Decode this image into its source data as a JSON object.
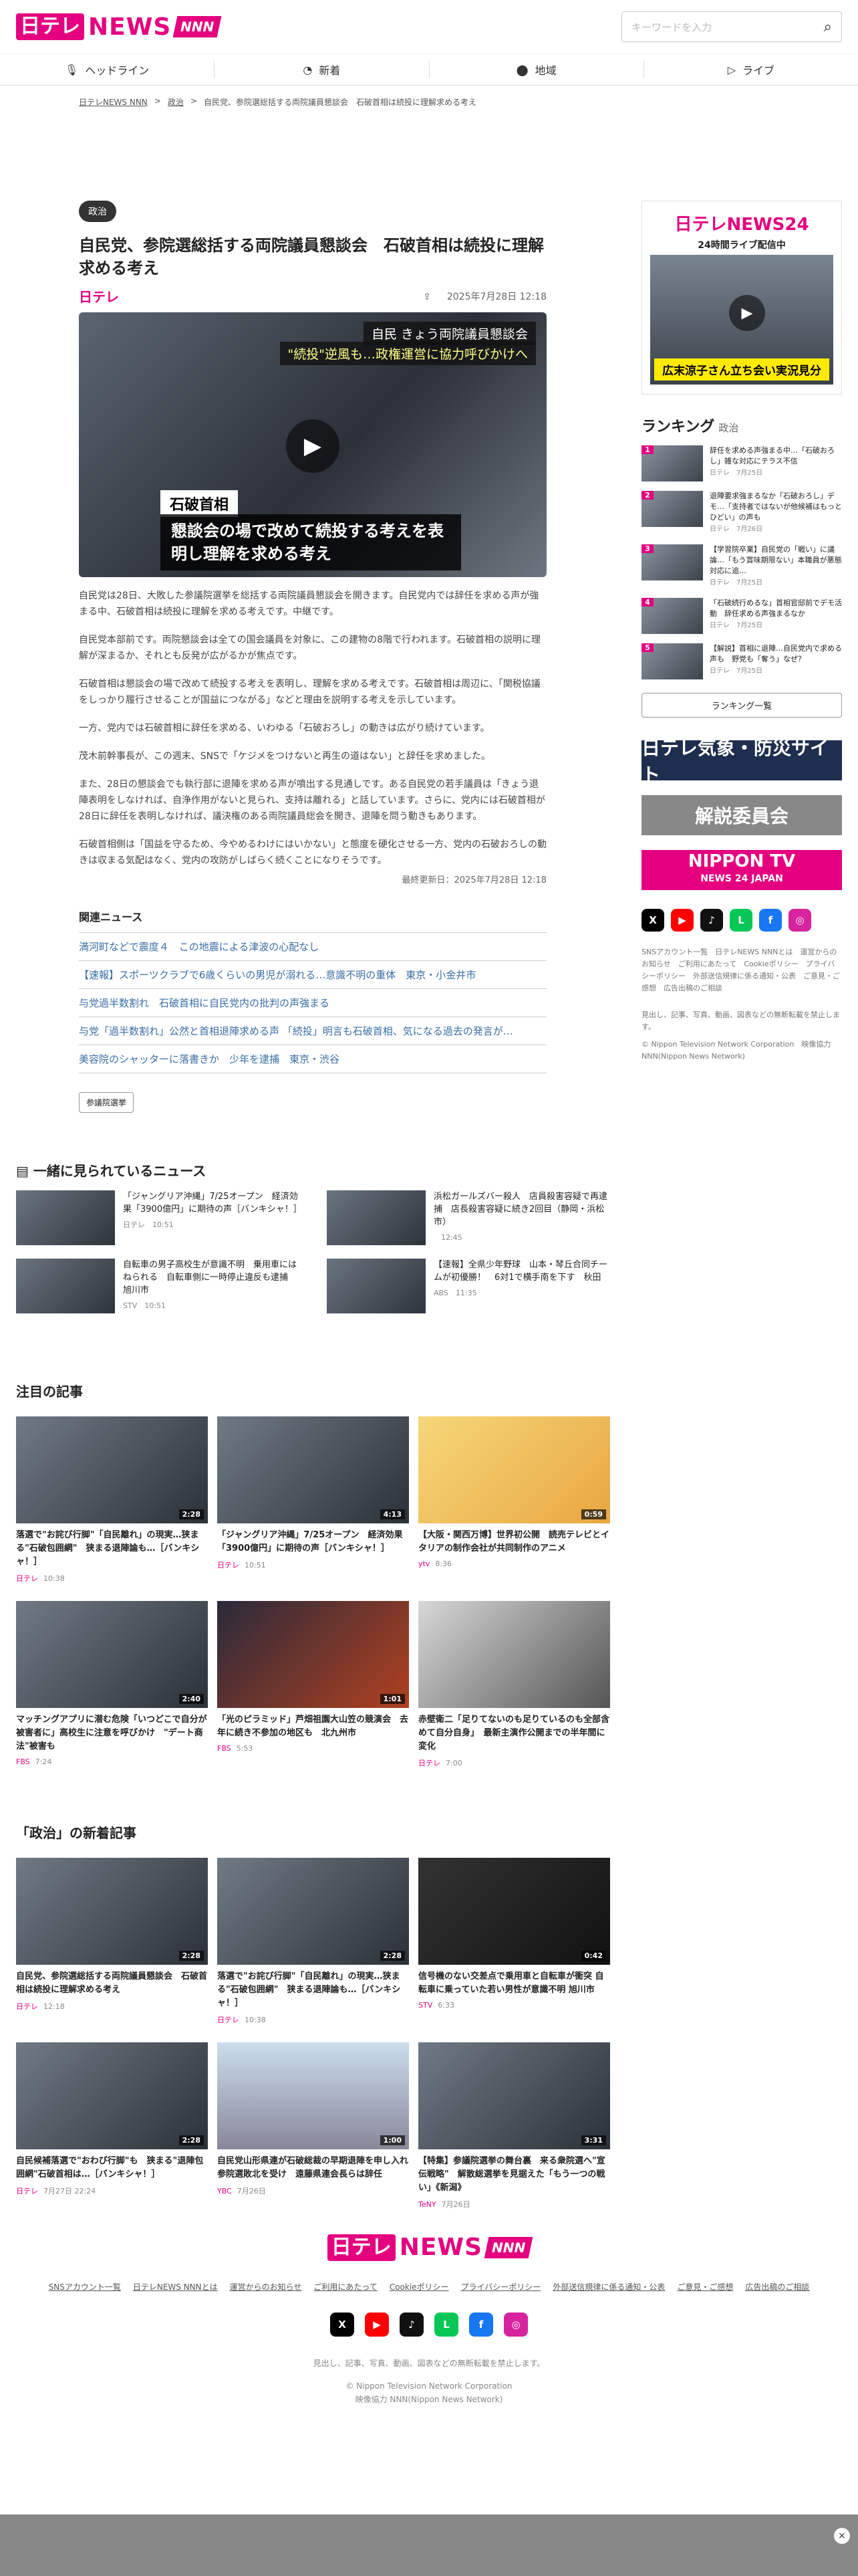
{
  "header": {
    "logo_ntv": "日テレ",
    "logo_news": "NEWS",
    "logo_nnn": "NNN",
    "search_placeholder": "キーワードを入力",
    "search_icon": "search-icon"
  },
  "nav": [
    {
      "label": "ヘッドライン",
      "icon": "mic-icon"
    },
    {
      "label": "新着",
      "icon": "new-icon"
    },
    {
      "label": "地域",
      "icon": "map-pin-icon"
    },
    {
      "label": "ライブ",
      "icon": "play-icon"
    }
  ],
  "breadcrumb": [
    "日テレNEWS NNN",
    "政治",
    "自民党、参院選総括する両院議員懇談会　石破首相は続投に理解求める考え"
  ],
  "article": {
    "category": "政治",
    "title": "自民党、参院選総括する両院議員懇談会　石破首相は続投に理解求める考え",
    "source": "日テレ",
    "date": "2025年7月28日 12:18",
    "hero_caption1": "自民 きょう両院議員懇談会",
    "hero_caption2": "\"続投\"逆風も…政権運営に協力呼びかけへ",
    "hero_name": "石破首相",
    "hero_sub": "懇談会の場で改めて続投する考えを表明し理解を求める考え",
    "paragraphs": [
      "自民党は28日、大敗した参議院選挙を総括する両院議員懇談会を開きます。自民党内では辞任を求める声が強まる中、石破首相は続投に理解を求める考えです。中継です。",
      "自民党本部前です。両院懇談会は全ての国会議員を対象に、この建物の8階で行われます。石破首相の説明に理解が深まるか、それとも反発が広がるかが焦点です。",
      "石破首相は懇談会の場で改めて続投する考えを表明し、理解を求める考えです。石破首相は周辺に、「関税協議をしっかり履行させることが国益につながる」などと理由を説明する考えを示しています。",
      "一方、党内では石破首相に辞任を求める、いわゆる「石破おろし」の動きは広がり続けています。",
      "茂木前幹事長が、この週末、SNSで「ケジメをつけないと再生の道はない」と辞任を求めました。",
      "また、28日の懇談会でも執行部に退陣を求める声が噴出する見通しです。ある自民党の若手議員は「きょう退陣表明をしなければ、自浄作用がないと見られ、支持は離れる」と話しています。さらに、党内には石破首相が28日に辞任を表明しなければ、議決権のある両院議員総会を開き、退陣を問う動きもあります。",
      "石破首相側は「国益を守るため、今やめるわけにはいかない」と態度を硬化させる一方、党内の石破おろしの動きは収まる気配はなく、党内の攻防がしばらく続くことになりそうです。"
    ],
    "updated": "最終更新日：2025年7月28日 12:18"
  },
  "related": {
    "heading": "関連ニュース",
    "items": [
      "満河町などで震度４　この地震による津波の心配なし",
      "【速報】スポーツクラブで6歳くらいの男児が溺れる…意識不明の重体　東京・小金井市",
      "与党過半数割れ　石破首相に自民党内の批判の声強まる",
      "与党「過半数割れ」公然と首相退陣求める声 「続投」明言も石破首相、気になる過去の発言が…",
      "美容院のシャッターに落書きか　少年を逮捕　東京・渋谷"
    ],
    "keyword": "参議院選挙"
  },
  "sidebar": {
    "live_title": "日テレNEWS24",
    "live_sub": "24時間ライブ配信中",
    "live_ticker": "広末涼子さん立ち会い実況見分",
    "ranking_heading": "ランキング",
    "ranking_category": "政治",
    "ranking": [
      {
        "rank": "1",
        "title": "辞任を求める声強まる中…「石破おろし」雑な対応にテラス不信",
        "src": "日テレ",
        "date": "7月25日"
      },
      {
        "rank": "2",
        "title": "退陣要求強まるなか「石破おろし」デモ…「支持者ではないが他候補はもっとひどい」の声も",
        "src": "日テレ",
        "date": "7月26日"
      },
      {
        "rank": "3",
        "title": "【学習院卒業】自民党の「戦い」に議論…「もう賞味期限ない」本職員が悪態対応に追…",
        "src": "日テレ",
        "date": "7月25日"
      },
      {
        "rank": "4",
        "title": "「石破続行めるな」首相官邸前でデモ活動　辞任求める声強まるなか",
        "src": "日テレ",
        "date": "7月25日"
      },
      {
        "rank": "5",
        "title": "【解説】首相に退陣…自民党内で求める声も　野党も「奪う」なぜ？",
        "src": "日テレ",
        "date": "7月25日"
      }
    ],
    "ranking_more": "ランキング一覧",
    "banner1": "日テレ気象・防災サイト",
    "banner2": "解説委員会",
    "banner3_line1": "NIPPON TV",
    "banner3_line2": "NEWS 24 JAPAN",
    "social": [
      "X",
      "▶",
      "♪",
      "L",
      "f",
      "◎"
    ],
    "links": "SNSアカウント一覧　日テレNEWS NNNとは　運営からのお知らせ　ご利用にあたって　Cookieポリシー　プライバシーポリシー　外部送信規律に係る通知・公表　ご意見・ご感想　広告出稿のご相談",
    "note": "見出し、記事、写真、動画、図表などの無断転載を禁止します。",
    "copyright": "© Nippon Television Network Corporation　映像協力 NNN(Nippon News Network)"
  },
  "together": {
    "heading": "一緒に見られているニュース",
    "items": [
      {
        "title": "「ジャングリア沖縄」7/25オープン　経済効果「3900億円」に期待の声［バンキシャ！］",
        "src": "日テレ",
        "date": "10:51"
      },
      {
        "title": "浜松ガールズバー殺人　店員殺害容疑で再逮捕　店長殺害容疑に続き2回目（静岡・浜松市）",
        "src": "",
        "date": "12:45"
      },
      {
        "title": "自転車の男子高校生が意識不明　乗用車にはねられる　自転車側に一時停止違反も逮捕　旭川市",
        "src": "STV",
        "date": "10:51"
      },
      {
        "title": "【速報】全県少年野球　山本・琴丘合同チームが初優勝！　6対1で横手南を下す　秋田",
        "src": "ABS",
        "date": "11:35"
      }
    ]
  },
  "featured": {
    "heading": "注目の記事",
    "items": [
      {
        "title": "落選で\"お詫び行脚\"「自民離れ」の現実…狭まる\"石破包囲網\"　狭まる退陣論も…［バンキシャ！］",
        "src": "日テレ",
        "date": "10:38",
        "dur": "2:28"
      },
      {
        "title": "「ジャングリア沖縄」7/25オープン　経済効果「3900億円」に期待の声［バンキシャ！］",
        "src": "日テレ",
        "date": "10:51",
        "dur": "4:13"
      },
      {
        "title": "【大阪・関西万博】世界初公開　読売テレビとイタリアの制作会社が共同制作のアニメ",
        "src": "ytv",
        "date": "8:36",
        "dur": "0:59"
      },
      {
        "title": "マッチングアプリに潜む危険「いつどこで自分が被害者に」高校生に注意を呼びかけ　\"デート商法\"被害も",
        "src": "FBS",
        "date": "7:24",
        "dur": "2:40"
      },
      {
        "title": "「光のピラミッド」芦畑祖園大山笠の競演会　去年に続き不参加の地区も　北九州市",
        "src": "FBS",
        "date": "5:53",
        "dur": "1:01"
      },
      {
        "title": "赤壁衛二「足りてないのも足りているのも全部含めて自分自身」　最新主演作公開までの半年間に変化",
        "src": "日テレ",
        "date": "7:00",
        "dur": ""
      }
    ]
  },
  "politics": {
    "heading": "「政治」の新着記事",
    "items": [
      {
        "title": "自民党、参院選総括する両院議員懇談会　石破首相は続投に理解求める考え",
        "src": "日テレ",
        "date": "12:18",
        "dur": "2:28"
      },
      {
        "title": "落選で\"お詫び行脚\"「自民離れ」の現実…狭まる\"石破包囲網\"　狭まる退陣論も…［バンキシャ！］",
        "src": "日テレ",
        "date": "10:38",
        "dur": "2:28"
      },
      {
        "title": "信号機のない交差点で乗用車と自転車が衝突 自転車に乗っていた若い男性が意識不明 旭川市",
        "src": "STV",
        "date": "6:33",
        "dur": "0:42"
      },
      {
        "title": "自民候補落選で\"おわび行脚\"も　狭まる\"退陣包囲網\"石破首相は…［バンキシャ！］",
        "src": "日テレ",
        "date": "7月27日 22:24",
        "dur": "2:28"
      },
      {
        "title": "自民党山形県連が石破総裁の早期退陣を申し入れ　参院選敗北を受け　遠藤県連会長らは辞任",
        "src": "YBC",
        "date": "7月26日",
        "dur": "1:00"
      },
      {
        "title": "【特集】参議院選挙の舞台裏　来る衆院選へ\"宣伝戦略\"　解散総選挙を見据えた「もう一つの戦い」《新潟》",
        "src": "TeNY",
        "date": "7月26日",
        "dur": "3:31"
      }
    ]
  },
  "footer": {
    "links": [
      "SNSアカウント一覧",
      "日テレNEWS NNNとは",
      "運営からのお知らせ",
      "ご利用にあたって",
      "Cookieポリシー",
      "プライバシーポリシー",
      "外部送信規律に係る通知・公表",
      "ご意見・ご感想",
      "広告出稿のご相談"
    ],
    "social": [
      "X",
      "▶",
      "♪",
      "L",
      "f",
      "◎"
    ],
    "note": "見出し、記事、写真、動画、図表などの無断転載を禁止します。",
    "copyright1": "© Nippon Television Network Corporation",
    "copyright2": "映像協力 NNN(Nippon News Network)"
  },
  "ad": {
    "close": "×"
  },
  "colors": {
    "brand": "#e4007f",
    "link": "#3a6ea5"
  }
}
